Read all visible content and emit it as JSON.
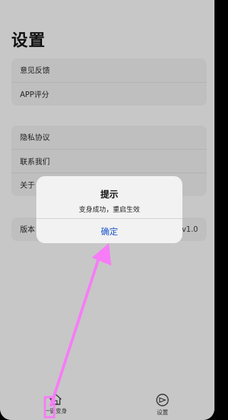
{
  "page": {
    "title": "设置"
  },
  "groups": [
    {
      "items": [
        {
          "label": "意见反馈"
        },
        {
          "label": "APP评分"
        }
      ]
    },
    {
      "items": [
        {
          "label": "隐私协议"
        },
        {
          "label": "联系我们"
        },
        {
          "label": "关于"
        }
      ]
    },
    {
      "items": [
        {
          "label": "版本",
          "value": "v1.0"
        }
      ]
    }
  ],
  "alert": {
    "title": "提示",
    "message": "变身成功，重启生效",
    "confirm": "确定"
  },
  "tabbar": {
    "tabs": [
      {
        "label": "一键变身",
        "icon": "home-icon"
      },
      {
        "label": "设置",
        "icon": "settings-icon"
      }
    ]
  },
  "colors": {
    "background": "#cbcbcb",
    "group": "#c3c3c3",
    "alert": "#f2f2f2",
    "accent": "#1a55c9",
    "annotation": "#f77cf7"
  }
}
